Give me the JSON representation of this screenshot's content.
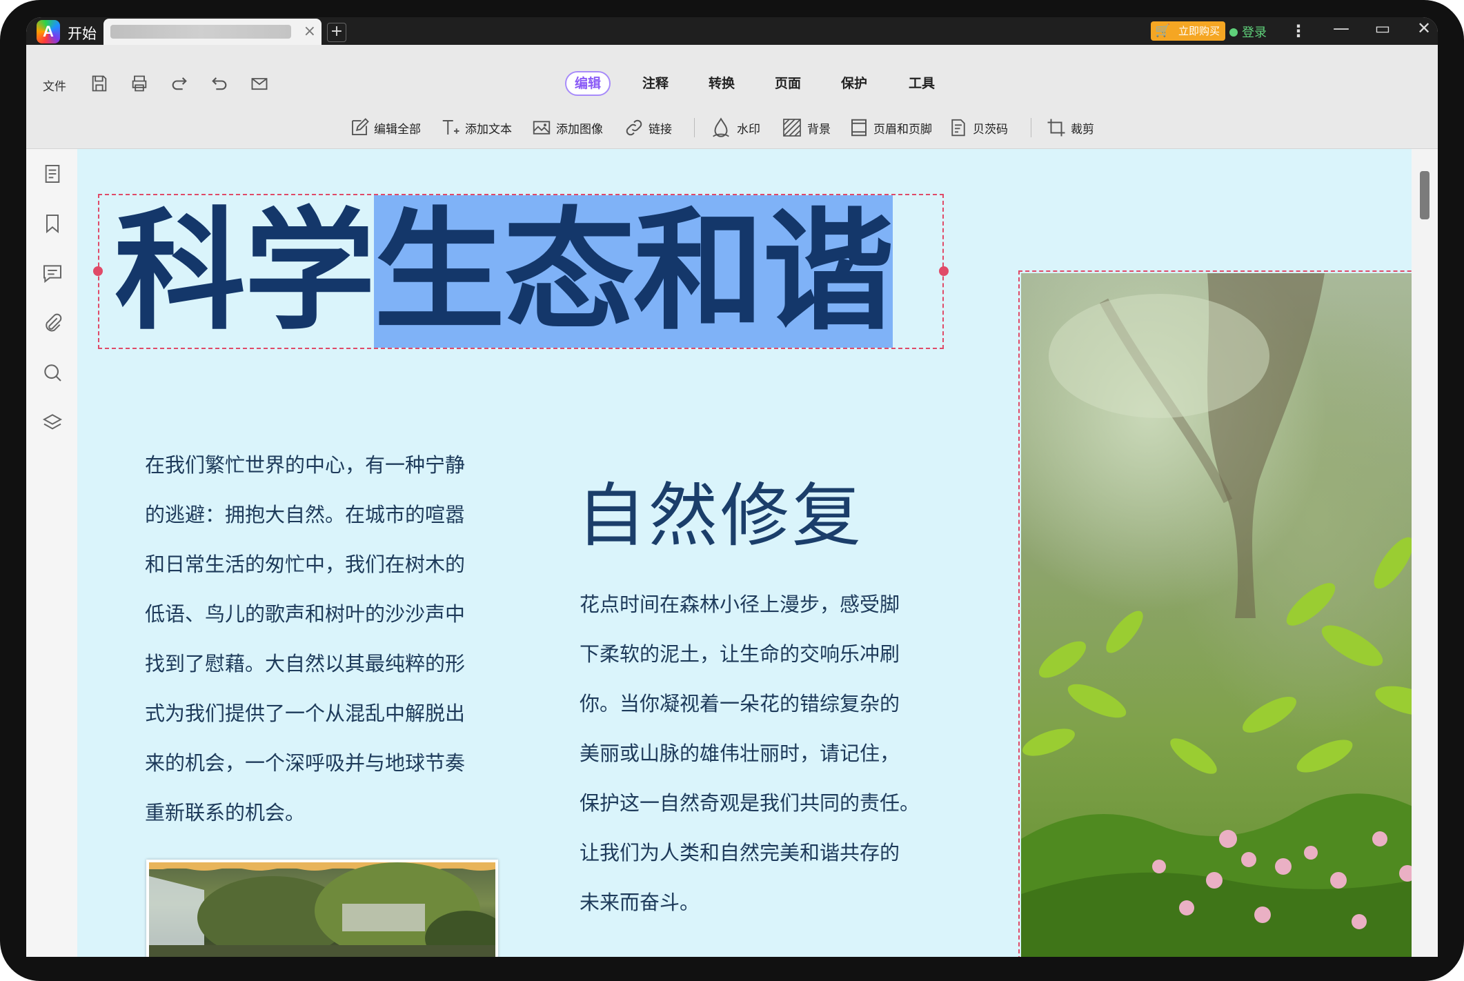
{
  "titlebar": {
    "home_label": "开始",
    "buy_label": "立即购买",
    "login_label": "登录",
    "minimize": "—",
    "maximize": "▭",
    "close": "✕"
  },
  "toolbar": {
    "file_label": "文件",
    "quick_actions": [
      "save-icon",
      "print-icon",
      "redo-icon",
      "undo-icon",
      "email-icon"
    ]
  },
  "tabs": [
    {
      "label": "编辑",
      "active": true
    },
    {
      "label": "注释",
      "active": false
    },
    {
      "label": "转换",
      "active": false
    },
    {
      "label": "页面",
      "active": false
    },
    {
      "label": "保护",
      "active": false
    },
    {
      "label": "工具",
      "active": false
    }
  ],
  "tools": [
    {
      "label": "编辑全部",
      "icon": "edit-all-icon"
    },
    {
      "label": "添加文本",
      "icon": "add-text-icon"
    },
    {
      "label": "添加图像",
      "icon": "add-image-icon"
    },
    {
      "label": "链接",
      "icon": "link-icon"
    },
    {
      "label": "水印",
      "icon": "watermark-icon"
    },
    {
      "label": "背景",
      "icon": "background-icon"
    },
    {
      "label": "页眉和页脚",
      "icon": "header-footer-icon"
    },
    {
      "label": "贝茨码",
      "icon": "bates-icon"
    },
    {
      "label": "裁剪",
      "icon": "crop-icon"
    }
  ],
  "sidebar": [
    "thumbnail-icon",
    "bookmark-icon",
    "comment-icon",
    "attachment-icon",
    "search-icon",
    "layers-icon"
  ],
  "document": {
    "title_plain": "科学",
    "title_selected": "生态和谐",
    "left_paragraph": "在我们繁忙世界的中心，有一种宁静\n的逃避：拥抱大自然。在城市的喧嚣\n和日常生活的匆忙中，我们在树木的\n低语、鸟儿的歌声和树叶的沙沙声中\n找到了慰藉。大自然以其最纯粹的形\n式为我们提供了一个从混乱中解脱出\n来的机会，一个深呼吸并与地球节奏\n重新联系的机会。",
    "subtitle": "自然修复",
    "right_paragraph": "花点时间在森林小径上漫步，感受脚\n下柔软的泥土，让生命的交响乐冲刷\n你。当你凝视着一朵花的错综复杂的\n美丽或山脉的雄伟壮丽时，请记住，\n保护这一自然奇观是我们共同的责任。\n让我们为人类和自然完美和谐共存的\n未来而奋斗。"
  },
  "colors": {
    "title": "#14376a",
    "selection": "#7fb2f7",
    "doc_background": "#daf4fb",
    "active_tab": "#8b5cf6",
    "selection_border": "#e04a68"
  }
}
